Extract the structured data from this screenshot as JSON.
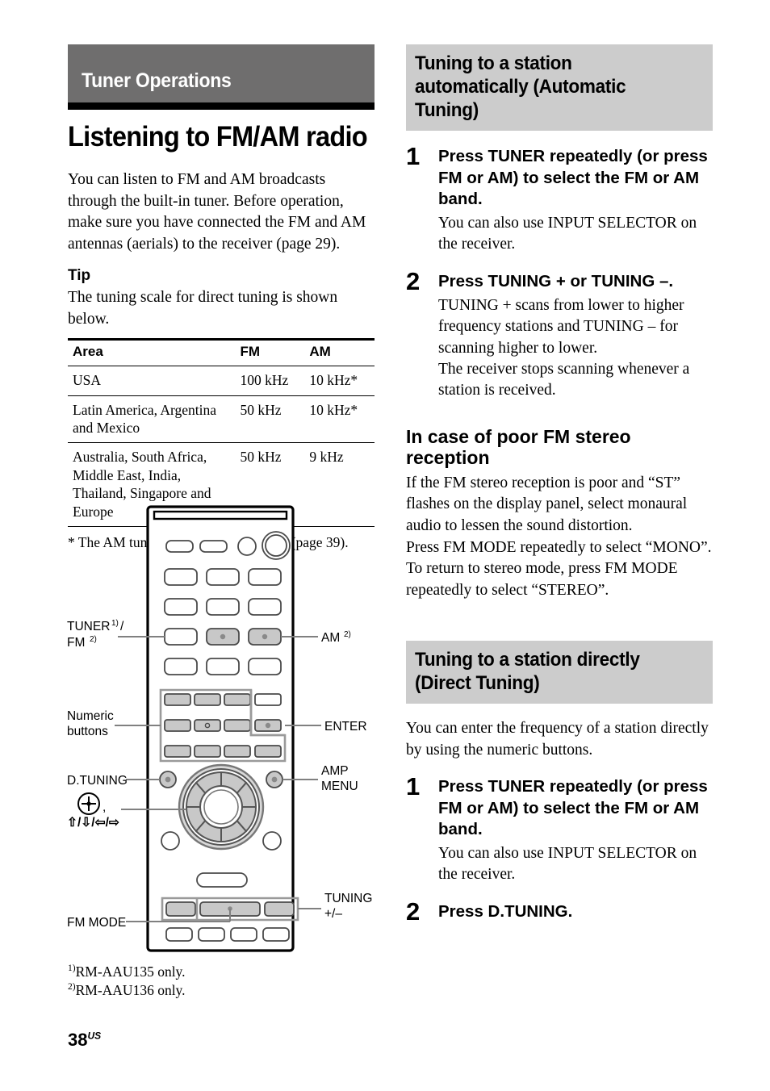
{
  "colors": {
    "banner_gray": "#6f6e6e",
    "section_gray": "#cccccc",
    "button_gray": "#c8c8c8"
  },
  "left": {
    "banner_title": "Tuner Operations",
    "page_title": "Listening to FM/AM radio",
    "intro": "You can listen to FM and AM broadcasts through the built-in tuner. Before operation, make sure you have connected the FM and AM antennas (aerials) to the receiver (page 29).",
    "tip_heading": "Tip",
    "tip_text": "The tuning scale for direct tuning is shown below.",
    "table": {
      "headers": [
        "Area",
        "FM",
        "AM"
      ],
      "rows": [
        {
          "area": "USA",
          "fm": "100 kHz",
          "am": "10 kHz*"
        },
        {
          "area": "Latin America, Argentina and Mexico",
          "fm": "50 kHz",
          "am": "10 kHz*"
        },
        {
          "area": "Australia, South Africa, Middle East, India, Thailand, Singapore and Europe",
          "fm": "50 kHz",
          "am": "9 kHz"
        }
      ]
    },
    "table_footnote": "* The AM tuning scale can be changed (page 39).",
    "diagram": {
      "labels": {
        "tuner_fm_line1": "TUNER",
        "tuner_fm_sup1": "1)",
        "tuner_fm_slash": "/",
        "tuner_fm_line2": "FM",
        "tuner_fm_sup2": "2)",
        "am": "AM",
        "am_sup": "2)",
        "numeric_line1": "Numeric",
        "numeric_line2": "buttons",
        "enter": "ENTER",
        "d_tuning": "D.TUNING",
        "amp_line1": "AMP",
        "amp_line2": "MENU",
        "cursor_symbols": "⬆/⬇/⬅/➡",
        "cursor_comma": ",",
        "tuning_line1": "TUNING",
        "tuning_line2": "+/–",
        "fm_mode": "FM MODE"
      }
    },
    "footnotes": [
      {
        "marker": "1)",
        "text": "RM-AAU135 only."
      },
      {
        "marker": "2)",
        "text": "RM-AAU136 only."
      }
    ],
    "folio": {
      "number": "38",
      "suffix": "US"
    }
  },
  "right": {
    "section1": {
      "heading_lines": [
        "Tuning to a station",
        "automatically (Automatic",
        "Tuning)"
      ],
      "steps": [
        {
          "num": "1",
          "title": "Press TUNER repeatedly (or press FM or AM) to select the FM or AM band.",
          "desc": "You can also use INPUT SELECTOR on the receiver."
        },
        {
          "num": "2",
          "title": "Press TUNING + or TUNING –.",
          "desc": "TUNING + scans from lower to higher frequency stations and TUNING – for scanning higher to lower.\nThe receiver stops scanning whenever a station is received."
        }
      ]
    },
    "subsection": {
      "heading_lines": [
        "In case of poor FM stereo",
        "reception"
      ],
      "text": "If the FM stereo reception is poor and “ST” flashes on the display panel, select monaural audio to lessen the sound distortion.\nPress FM MODE repeatedly to select “MONO”.\nTo return to stereo mode, press FM MODE repeatedly to select “STEREO”."
    },
    "section2": {
      "heading_lines": [
        "Tuning to a station directly",
        "(Direct Tuning)"
      ],
      "intro": "You can enter the frequency of a station directly by using the numeric buttons.",
      "steps": [
        {
          "num": "1",
          "title": "Press TUNER repeatedly (or press FM or AM) to select the FM or AM band.",
          "desc": "You can also use INPUT SELECTOR on the receiver."
        },
        {
          "num": "2",
          "title": "Press D.TUNING.",
          "desc": ""
        }
      ]
    }
  }
}
